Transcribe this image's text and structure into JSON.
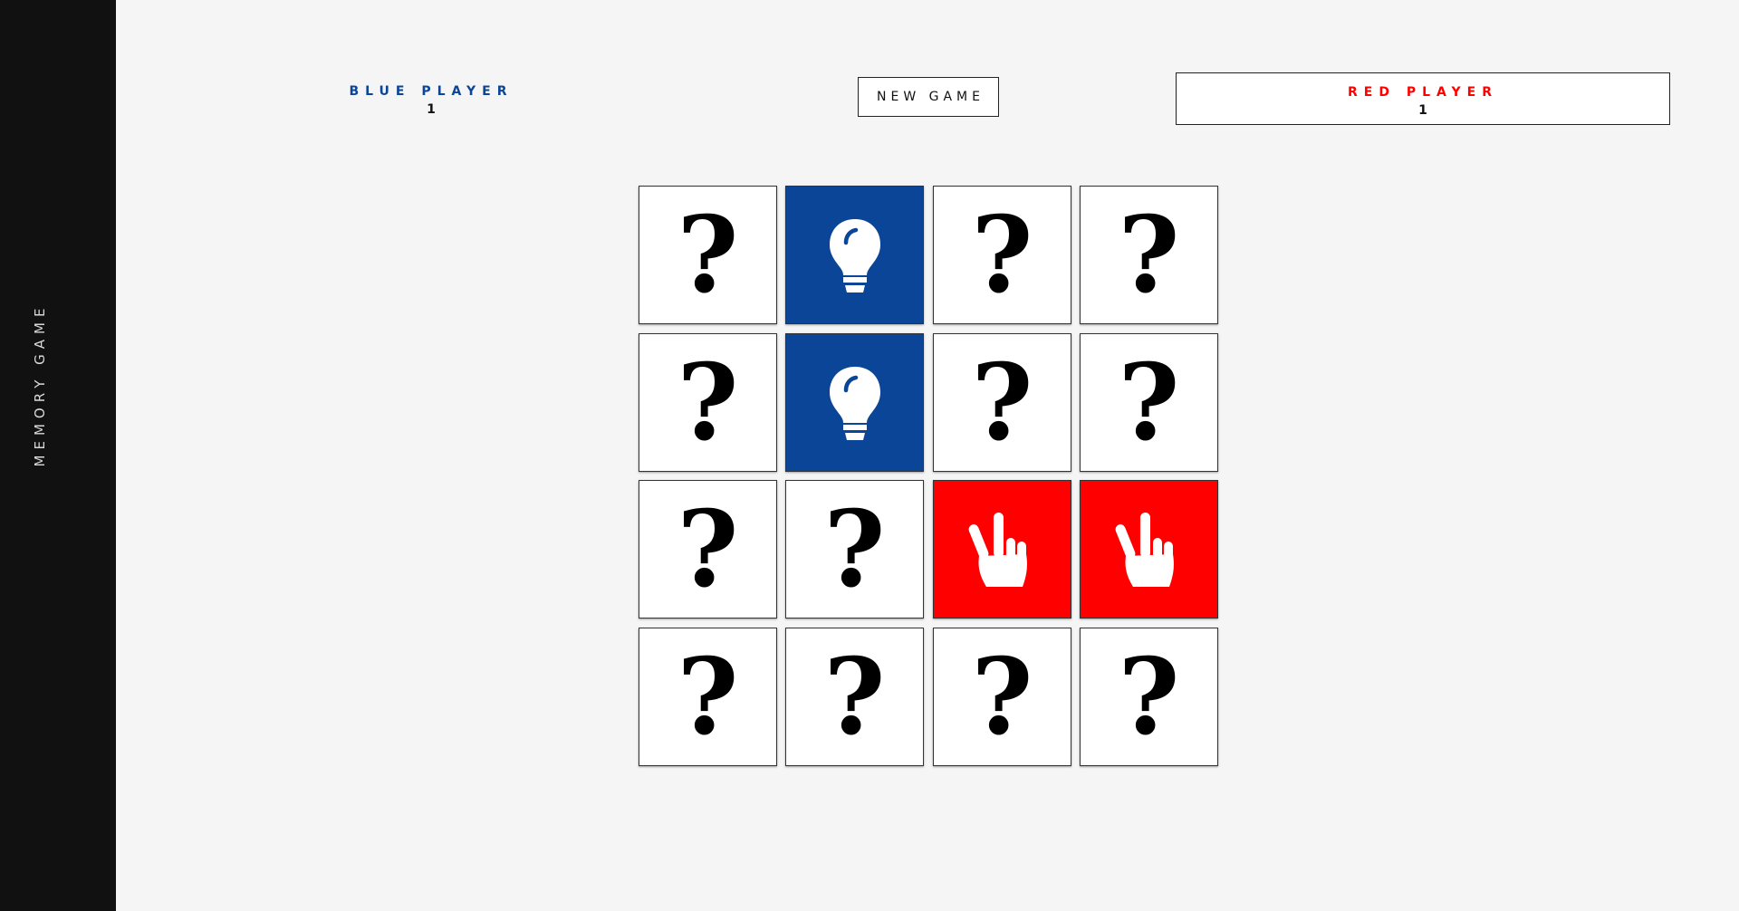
{
  "sidebar": {
    "title": "MEMORY GAME"
  },
  "players": {
    "blue": {
      "name": "BLUE PLAYER",
      "score": "1",
      "color": "#0b4597"
    },
    "red": {
      "name": "RED PLAYER",
      "score": "1",
      "color": "#ff0000"
    }
  },
  "controls": {
    "new_game_label": "NEW GAME"
  },
  "board": {
    "rows": 4,
    "cols": 4,
    "hidden_symbol": "?",
    "cards": [
      {
        "state": "hidden",
        "icon": "question-mark-icon"
      },
      {
        "state": "matched",
        "owner": "blue",
        "icon": "lightbulb-icon"
      },
      {
        "state": "hidden",
        "icon": "question-mark-icon"
      },
      {
        "state": "hidden",
        "icon": "question-mark-icon"
      },
      {
        "state": "hidden",
        "icon": "question-mark-icon"
      },
      {
        "state": "matched",
        "owner": "blue",
        "icon": "lightbulb-icon"
      },
      {
        "state": "hidden",
        "icon": "question-mark-icon"
      },
      {
        "state": "hidden",
        "icon": "question-mark-icon"
      },
      {
        "state": "hidden",
        "icon": "question-mark-icon"
      },
      {
        "state": "hidden",
        "icon": "question-mark-icon"
      },
      {
        "state": "matched",
        "owner": "red",
        "icon": "hand-peace-icon"
      },
      {
        "state": "matched",
        "owner": "red",
        "icon": "hand-peace-icon"
      },
      {
        "state": "hidden",
        "icon": "question-mark-icon"
      },
      {
        "state": "hidden",
        "icon": "question-mark-icon"
      },
      {
        "state": "hidden",
        "icon": "question-mark-icon"
      },
      {
        "state": "hidden",
        "icon": "question-mark-icon"
      }
    ]
  }
}
